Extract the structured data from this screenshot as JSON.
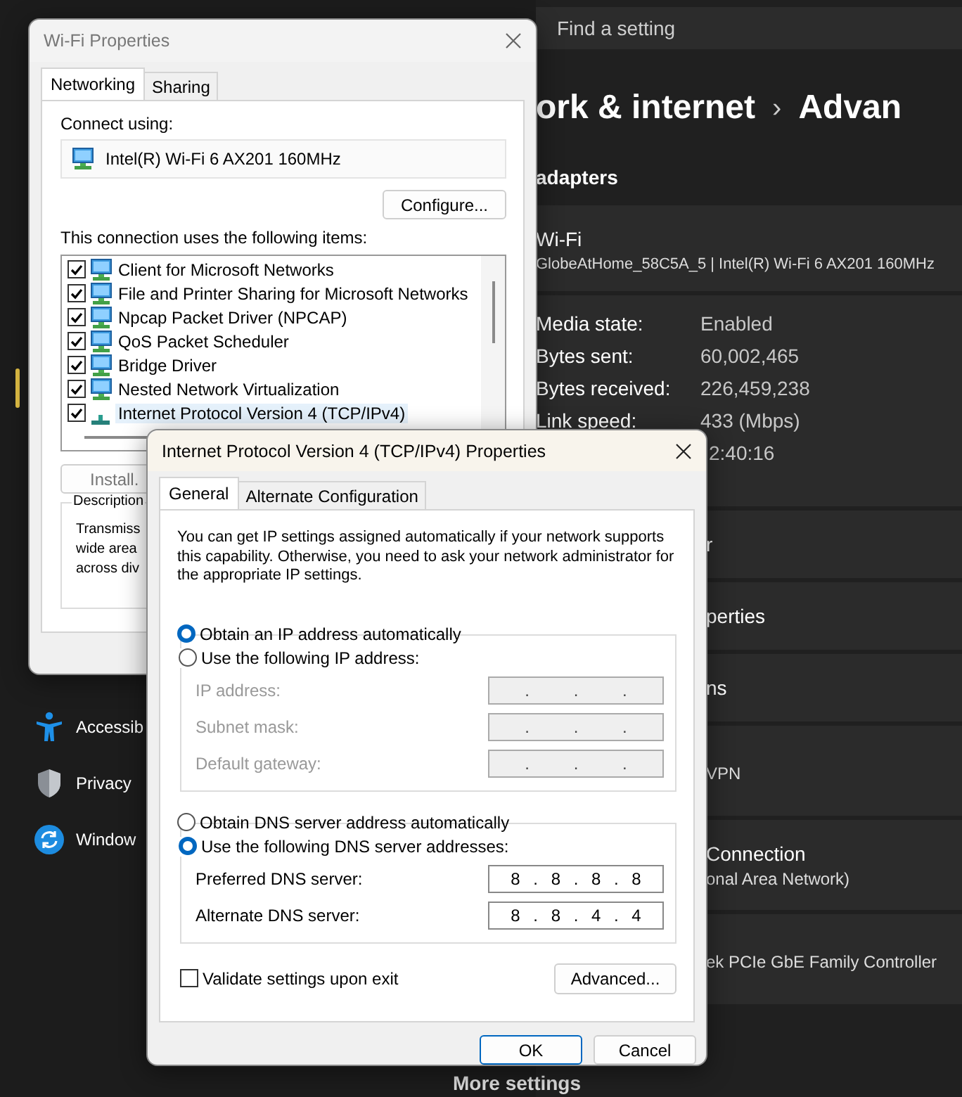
{
  "settings": {
    "search": {
      "placeholder": "Find a setting"
    },
    "breadcrumb": {
      "parent": "ork & internet",
      "separator": "›",
      "current": "Advan"
    },
    "section_title": "adapters",
    "adapter": {
      "name": "Wi-Fi",
      "detail": "GlobeAtHome_58C5A_5 | Intel(R) Wi-Fi 6 AX201 160MHz"
    },
    "details": [
      {
        "label": "Media state:",
        "value": "Enabled"
      },
      {
        "label": "Bytes sent:",
        "value": "60,002,465"
      },
      {
        "label": "Bytes received:",
        "value": "226,459,238"
      },
      {
        "label": "Link speed:",
        "value": "433 (Mbps)"
      },
      {
        "value": "2:40:16"
      }
    ],
    "rows": [
      {
        "kind": "row",
        "title": "r"
      },
      {
        "kind": "row",
        "title": "perties"
      },
      {
        "kind": "row",
        "title": "ns"
      },
      {
        "kind": "card",
        "subtitle": "VPN"
      },
      {
        "kind": "card",
        "title": "Connection",
        "subtitle": "onal Area Network)"
      },
      {
        "kind": "card",
        "subtitle": "ek PCIe GbE Family Controller"
      }
    ],
    "more": "More settings"
  },
  "sidebar": {
    "items": [
      {
        "kind": "accessibility",
        "label": "Accessib"
      },
      {
        "kind": "privacy",
        "label": "Privacy"
      },
      {
        "kind": "update",
        "label": "Window"
      }
    ]
  },
  "wifi_properties": {
    "title": "Wi-Fi Properties",
    "tabs": [
      {
        "label": "Networking",
        "selected": true
      },
      {
        "label": "Sharing",
        "selected": false
      }
    ],
    "connect_label": "Connect using:",
    "adapter": "Intel(R) Wi-Fi 6 AX201 160MHz",
    "configure": "Configure...",
    "items_label": "This connection uses the following items:",
    "items": [
      {
        "kind": "client",
        "label": "Client for Microsoft Networks",
        "checked": true,
        "selected": false
      },
      {
        "kind": "client",
        "label": "File and Printer Sharing for Microsoft Networks",
        "checked": true,
        "selected": false
      },
      {
        "kind": "client",
        "label": "Npcap Packet Driver (NPCAP)",
        "checked": true,
        "selected": false
      },
      {
        "kind": "client",
        "label": "QoS Packet Scheduler",
        "checked": true,
        "selected": false
      },
      {
        "kind": "client",
        "label": "Bridge Driver",
        "checked": true,
        "selected": false
      },
      {
        "kind": "client",
        "label": "Nested Network Virtualization",
        "checked": true,
        "selected": false
      },
      {
        "kind": "protocol",
        "label": "Internet Protocol Version 4 (TCP/IPv4)",
        "checked": true,
        "selected": true
      }
    ],
    "install": "Install.",
    "description": {
      "legend": "Description",
      "lines": [
        "Transmiss",
        "wide area",
        "across div"
      ]
    }
  },
  "ipv4_dialog": {
    "title": "Internet Protocol Version 4 (TCP/IPv4) Properties",
    "tabs": [
      {
        "label": "General",
        "selected": true
      },
      {
        "label": "Alternate Configuration",
        "selected": false
      }
    ],
    "intro": "You can get IP settings assigned automatically if your network supports this capability. Otherwise, you need to ask your network administrator for the appropriate IP settings.",
    "ip_auto": {
      "label": "Obtain an IP address automatically",
      "selected": true
    },
    "ip_manual": {
      "label": "Use the following IP address:",
      "selected": false,
      "fields": [
        {
          "label": "IP address:",
          "value": ". . ."
        },
        {
          "label": "Subnet mask:",
          "value": ". . ."
        },
        {
          "label": "Default gateway:",
          "value": ". . ."
        }
      ]
    },
    "dns_auto": {
      "label": "Obtain DNS server address automatically",
      "selected": false
    },
    "dns_manual": {
      "label": "Use the following DNS server addresses:",
      "selected": true,
      "fields": [
        {
          "label": "Preferred DNS server:",
          "value": "8 . 8 . 8 . 8"
        },
        {
          "label": "Alternate DNS server:",
          "value": "8 . 8 . 4 . 4"
        }
      ]
    },
    "validate": {
      "label": "Validate settings upon exit",
      "checked": false
    },
    "advanced": "Advanced...",
    "buttons": [
      {
        "label": "OK",
        "default": true
      },
      {
        "label": "Cancel",
        "default": false
      }
    ]
  }
}
